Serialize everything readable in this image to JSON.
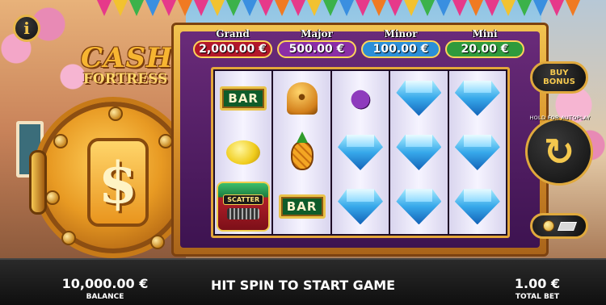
{
  "game": {
    "logo_line1": "CASH",
    "logo_line2": "FORTRESS",
    "info_icon": "i"
  },
  "jackpots": [
    {
      "name": "Grand",
      "value": "2,000.00 €",
      "color": "#b3182a"
    },
    {
      "name": "Major",
      "value": "500.00 €",
      "color": "#8b2ea6"
    },
    {
      "name": "Minor",
      "value": "100.00 €",
      "color": "#2b8fd8"
    },
    {
      "name": "Mini",
      "value": "20.00 €",
      "color": "#2e9a3c"
    }
  ],
  "reels": [
    [
      "bar",
      "lemon",
      "scatter"
    ],
    [
      "bell",
      "pineapple",
      "bar"
    ],
    [
      "grapes",
      "diamond",
      "diamond"
    ],
    [
      "diamond",
      "diamond",
      "diamond"
    ],
    [
      "diamond",
      "diamond",
      "diamond"
    ]
  ],
  "symbols": {
    "bar_label": "BAR",
    "scatter_label": "SCATTER"
  },
  "controls": {
    "buy_bonus_label": "BUY\nBONUS",
    "spin_caption": "HOLD FOR AUTOPLAY",
    "spin_icon": "↻"
  },
  "footer": {
    "balance_value": "10,000.00 €",
    "balance_label": "BALANCE",
    "message": "HIT SPIN TO START GAME",
    "total_bet_value": "1.00 €",
    "total_bet_label": "TOTAL BET"
  },
  "colors": {
    "gold": "#e3a73a",
    "machine_bg": "#3d1350"
  }
}
